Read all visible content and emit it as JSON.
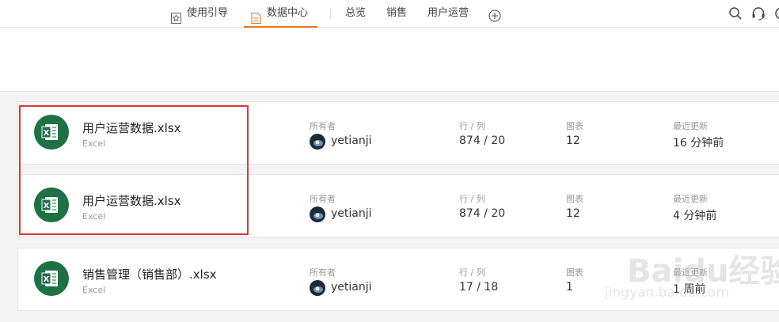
{
  "nav": {
    "guide": "使用引导",
    "data_center": "数据中心",
    "overview": "总览",
    "sales": "销售",
    "user_ops": "用户运营",
    "accent_color": "#e8731f"
  },
  "columns": {
    "owner": "所有者",
    "rows_cols": "行 / 列",
    "charts": "图表",
    "updated": "最近更新"
  },
  "files": [
    {
      "name": "用户运营数据.xlsx",
      "type": "Excel",
      "owner": "yetianji",
      "rows_cols": "874 / 20",
      "charts": "12",
      "updated": "16 分钟前"
    },
    {
      "name": "用户运营数据.xlsx",
      "type": "Excel",
      "owner": "yetianji",
      "rows_cols": "874 / 20",
      "charts": "12",
      "updated": "4 分钟前"
    },
    {
      "name": "销售管理（销售部）.xlsx",
      "type": "Excel",
      "owner": "yetianji",
      "rows_cols": "17 / 18",
      "charts": "1",
      "updated": "1 周前"
    }
  ],
  "watermark": {
    "text": "Baidu经验",
    "url": "jingyan.baidu.com"
  },
  "icons": {
    "file": "excel-file-icon",
    "highlight_color": "#e0373a",
    "excel_green": "#1e7145"
  }
}
